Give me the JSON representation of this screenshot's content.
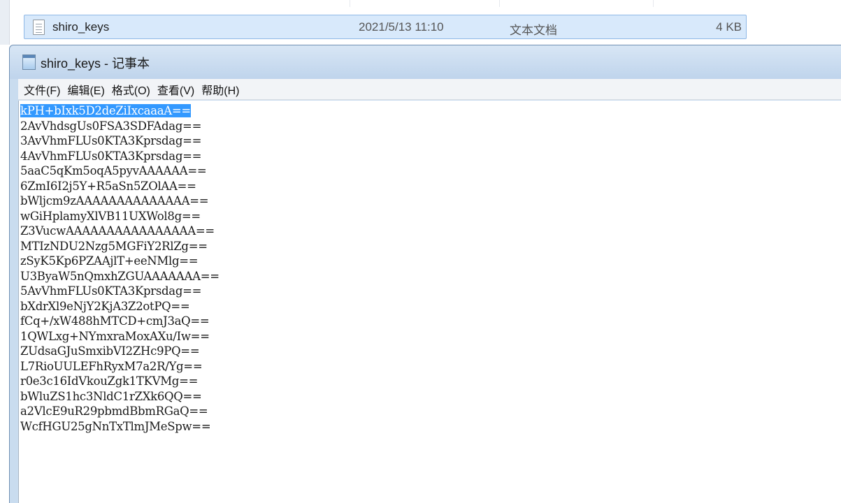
{
  "explorer": {
    "file": {
      "name": "shiro_keys",
      "modified": "2021/5/13 11:10",
      "type": "文本文档",
      "size": "4 KB"
    }
  },
  "notepad": {
    "title": "shiro_keys - 记事本",
    "menu": [
      "文件(F)",
      "编辑(E)",
      "格式(O)",
      "查看(V)",
      "帮助(H)"
    ],
    "lines": [
      "kPH+bIxk5D2deZiIxcaaaA==",
      "2AvVhdsgUs0FSA3SDFAdag==",
      "3AvVhmFLUs0KTA3Kprsdag==",
      "4AvVhmFLUs0KTA3Kprsdag==",
      "5aaC5qKm5oqA5pyvAAAAAA==",
      "6ZmI6I2j5Y+R5aSn5ZOlAA==",
      "bWljcm9zAAAAAAAAAAAAAA==",
      "wGiHplamyXlVB11UXWol8g==",
      "Z3VucwAAAAAAAAAAAAAAAA==",
      "MTIzNDU2Nzg5MGFiY2RlZg==",
      "zSyK5Kp6PZAAjlT+eeNMlg==",
      "U3ByaW5nQmxhZGUAAAAAAA==",
      "5AvVhmFLUs0KTA3Kprsdag==",
      "bXdrXl9eNjY2KjA3Z2otPQ==",
      "fCq+/xW488hMTCD+cmJ3aQ==",
      "1QWLxg+NYmxraMoxAXu/Iw==",
      "ZUdsaGJuSmxibVI2ZHc9PQ==",
      "L7RioUULEFhRyxM7a2R/Yg==",
      "r0e3c16IdVkouZgk1TKVMg==",
      "bWluZS1hc3NldC1rZXk6QQ==",
      "a2VlcE9uR29pbmdBbmRGaQ==",
      "WcfHGU25gNnTxTlmJMeSpw=="
    ],
    "selected_line_index": 0
  }
}
